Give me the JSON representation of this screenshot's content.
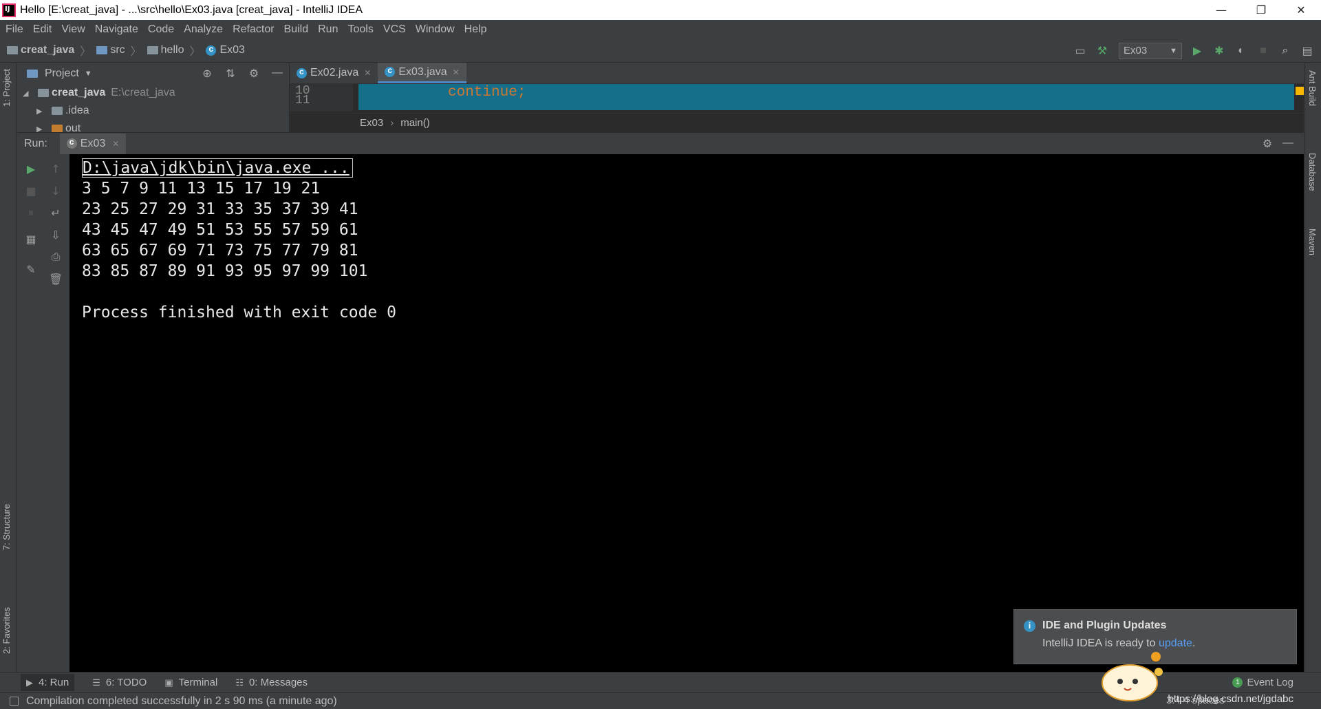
{
  "window": {
    "title": "Hello [E:\\creat_java] - ...\\src\\hello\\Ex03.java [creat_java] - IntelliJ IDEA",
    "controls": [
      "—",
      "❐",
      "✕"
    ]
  },
  "menu": [
    "File",
    "Edit",
    "View",
    "Navigate",
    "Code",
    "Analyze",
    "Refactor",
    "Build",
    "Run",
    "Tools",
    "VCS",
    "Window",
    "Help"
  ],
  "breadcrumb": {
    "project": "creat_java",
    "src": "src",
    "pkg": "hello",
    "file": "Ex03"
  },
  "run_config": "Ex03",
  "left_tabs": [
    "1: Project",
    "7: Structure",
    "2: Favorites"
  ],
  "right_tabs": [
    "Ant Build",
    "Database",
    "Maven"
  ],
  "project_panel": {
    "title": "Project",
    "root": {
      "name": "creat_java",
      "path": "E:\\creat_java"
    },
    "children": [
      ".idea",
      "out"
    ]
  },
  "editor": {
    "tabs": [
      {
        "label": "Ex02.java",
        "active": false
      },
      {
        "label": "Ex03.java",
        "active": true
      }
    ],
    "line_numbers": [
      "10",
      "11"
    ],
    "code": "continue;",
    "code_breadcrumb": {
      "cls": "Ex03",
      "method": "main()"
    }
  },
  "run": {
    "label": "Run:",
    "tab": "Ex03",
    "console": [
      "D:\\java\\jdk\\bin\\java.exe ...",
      "3 5 7 9 11 13 15 17 19 21",
      "23 25 27 29 31 33 35 37 39 41",
      "43 45 47 49 51 53 55 57 59 61",
      "63 65 67 69 71 73 75 77 79 81",
      "83 85 87 89 91 93 95 97 99 101",
      "",
      "Process finished with exit code 0"
    ]
  },
  "notification": {
    "title": "IDE and Plugin Updates",
    "body_prefix": "IntelliJ IDEA is ready to ",
    "link": "update",
    "body_suffix": "."
  },
  "bottom_tabs": [
    "4: Run",
    "6: TODO",
    "Terminal",
    "0: Messages"
  ],
  "event_log": {
    "count": "1",
    "label": "Event Log"
  },
  "status": {
    "message": "Compilation completed successfully in 2 s 90 ms (a minute ago)",
    "right": "3:4   4 spaces",
    "watermark": "https://blog.csdn.net/jgdabc"
  },
  "colors": {
    "accent": "#4a88c7",
    "highlight_line": "#156f8a",
    "keyword": "#cc7832",
    "success": "#499c54"
  }
}
